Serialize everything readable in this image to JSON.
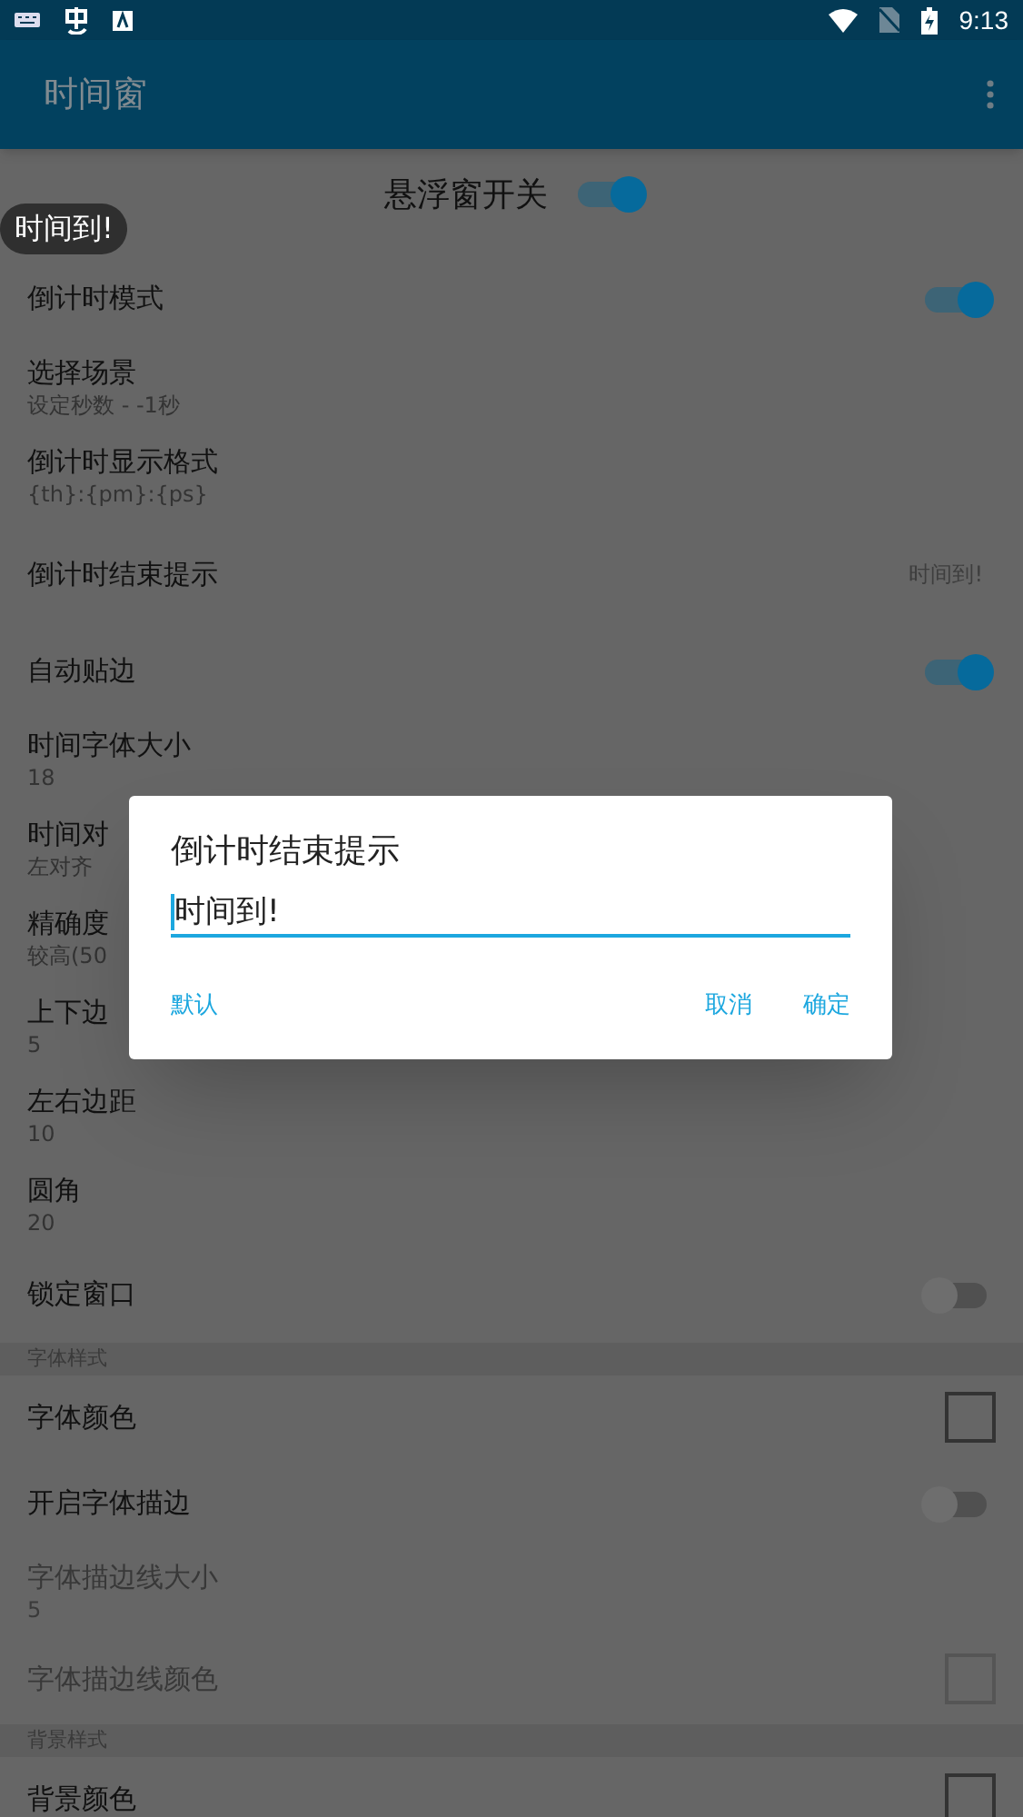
{
  "status_bar": {
    "time": "9:13"
  },
  "app_bar": {
    "title": "时间窗"
  },
  "float_switch": {
    "label": "悬浮窗开关",
    "on": true
  },
  "toast": {
    "text": "时间到!"
  },
  "settings": [
    {
      "kind": "switch",
      "title": "倒计时模式",
      "on": true,
      "disabled": false
    },
    {
      "kind": "summary",
      "title": "选择场景",
      "summary": "设定秒数 - -1秒",
      "disabled": false
    },
    {
      "kind": "summary",
      "title": "倒计时显示格式",
      "summary": "{th}:{pm}:{ps}",
      "disabled": false
    },
    {
      "kind": "value",
      "title": "倒计时结束提示",
      "value": "时间到!",
      "disabled": false
    },
    {
      "kind": "switch",
      "title": "自动贴边",
      "on": true,
      "disabled": false
    },
    {
      "kind": "summary",
      "title": "时间字体大小",
      "summary": "18",
      "disabled": false
    },
    {
      "kind": "summary",
      "title": "时间对",
      "summary": "左对齐",
      "disabled": false
    },
    {
      "kind": "summary",
      "title": "精确度",
      "summary": "较高(50",
      "disabled": false
    },
    {
      "kind": "summary",
      "title": "上下边",
      "summary": "5",
      "disabled": false
    },
    {
      "kind": "summary",
      "title": "左右边距",
      "summary": "10",
      "disabled": false
    },
    {
      "kind": "summary",
      "title": "圆角",
      "summary": "20",
      "disabled": false
    },
    {
      "kind": "switch",
      "title": "锁定窗口",
      "on": false,
      "disabled": false
    },
    {
      "kind": "header",
      "title": "字体样式"
    },
    {
      "kind": "color",
      "title": "字体颜色",
      "disabled": false
    },
    {
      "kind": "switch",
      "title": "开启字体描边",
      "on": false,
      "disabled": false
    },
    {
      "kind": "summary",
      "title": "字体描边线大小",
      "summary": "5",
      "disabled": true
    },
    {
      "kind": "color",
      "title": "字体描边线颜色",
      "disabled": true
    },
    {
      "kind": "header",
      "title": "背景样式"
    },
    {
      "kind": "color",
      "title": "背景颜色",
      "disabled": false
    }
  ],
  "dialog": {
    "title": "倒计时结束提示",
    "value": "时间到!",
    "buttons": [
      {
        "label": "默认",
        "kind": "left"
      },
      {
        "label": "取消",
        "kind": "right"
      },
      {
        "label": "确定",
        "kind": "right"
      }
    ]
  }
}
